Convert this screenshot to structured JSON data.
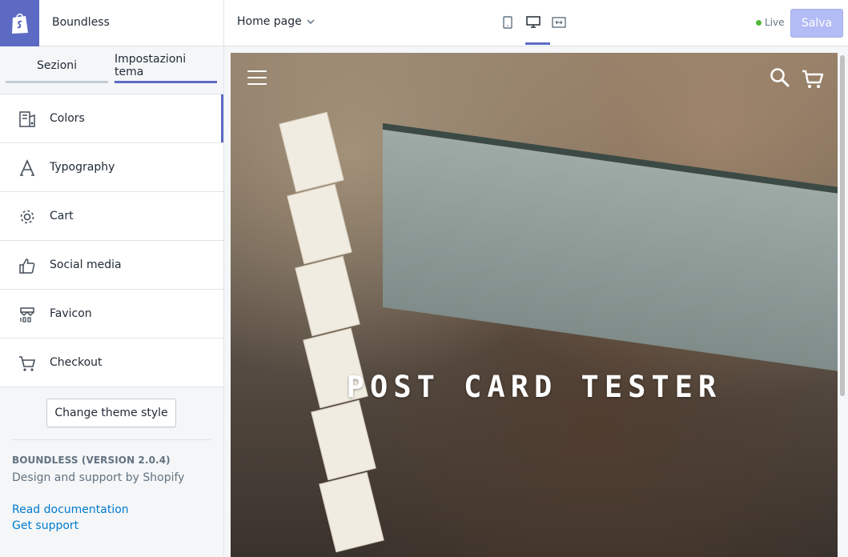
{
  "header": {
    "theme_name": "Boundless",
    "page_select": "Home page",
    "live_label": "Live",
    "save_label": "Salva"
  },
  "tabs": [
    {
      "label": "Sezioni"
    },
    {
      "label": "Impostazioni tema"
    }
  ],
  "menu": [
    {
      "label": "Colors",
      "icon": "colors-icon"
    },
    {
      "label": "Typography",
      "icon": "typography-icon"
    },
    {
      "label": "Cart",
      "icon": "gear-icon"
    },
    {
      "label": "Social media",
      "icon": "thumbs-up-icon"
    },
    {
      "label": "Favicon",
      "icon": "favicon-icon"
    },
    {
      "label": "Checkout",
      "icon": "cart-icon"
    }
  ],
  "sidebar_footer": {
    "change_style_label": "Change theme style",
    "version": "BOUNDLESS (VERSION 2.0.4)",
    "support_text": "Design and support by Shopify",
    "doc_link": "Read documentation",
    "support_link": "Get support"
  },
  "preview": {
    "hero_title": "POST CARD TESTER"
  },
  "colors": {
    "accent": "#5c6ac4",
    "link": "#007ace",
    "live": "#50b83c"
  }
}
